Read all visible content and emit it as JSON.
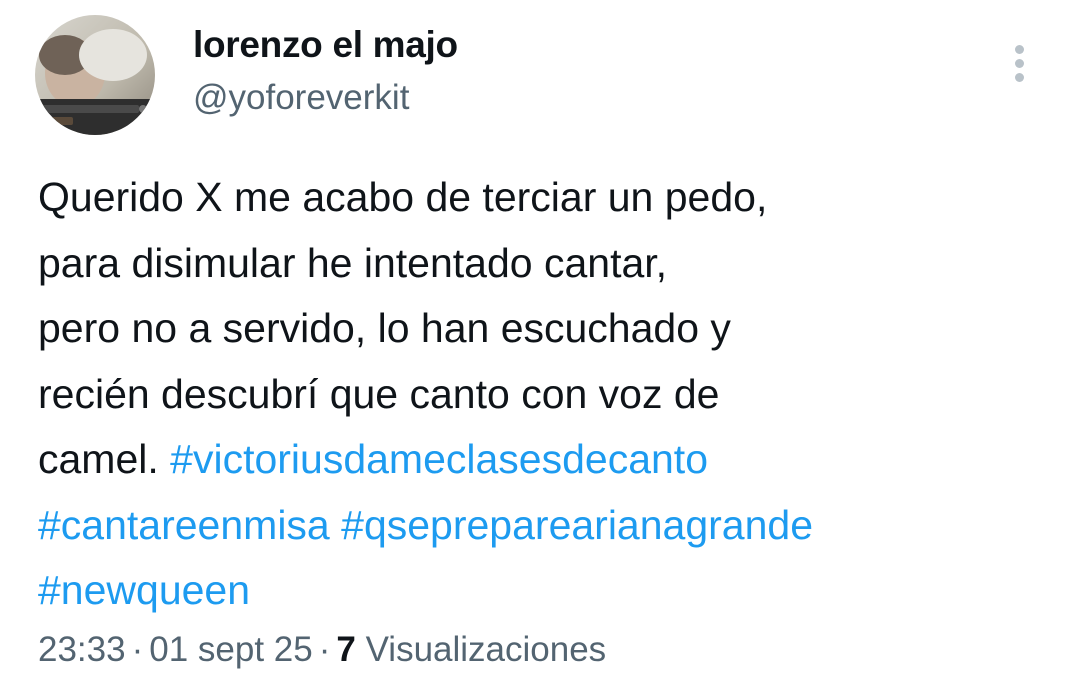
{
  "author": {
    "display_name": "lorenzo el majo",
    "handle": "@yoforeverkit",
    "avatar_icon": "profile-photo"
  },
  "tweet": {
    "lines": [
      [
        "Querido X me acabo de terciar un pedo,"
      ],
      [
        "para disimular he intentado cantar,"
      ],
      [
        "pero no a servido, lo han escuchado y"
      ],
      [
        "recién descubrí que canto con voz de"
      ]
    ],
    "line5_text": "camel. ",
    "hashtags": [
      "#victoriusdameclasesdecanto",
      "#cantareenmisa",
      "#qsepreparearianagrande",
      "#newqueen"
    ]
  },
  "meta": {
    "time": "23:33",
    "separator": "·",
    "date": "01 sept 25",
    "views_count": "7",
    "views_label": "Visualizaciones"
  },
  "colors": {
    "text": "#0f1419",
    "secondary": "#536471",
    "link": "#1d9bf0",
    "more_dots": "#b9c2c9"
  },
  "more_icon": "more-vertical-icon"
}
